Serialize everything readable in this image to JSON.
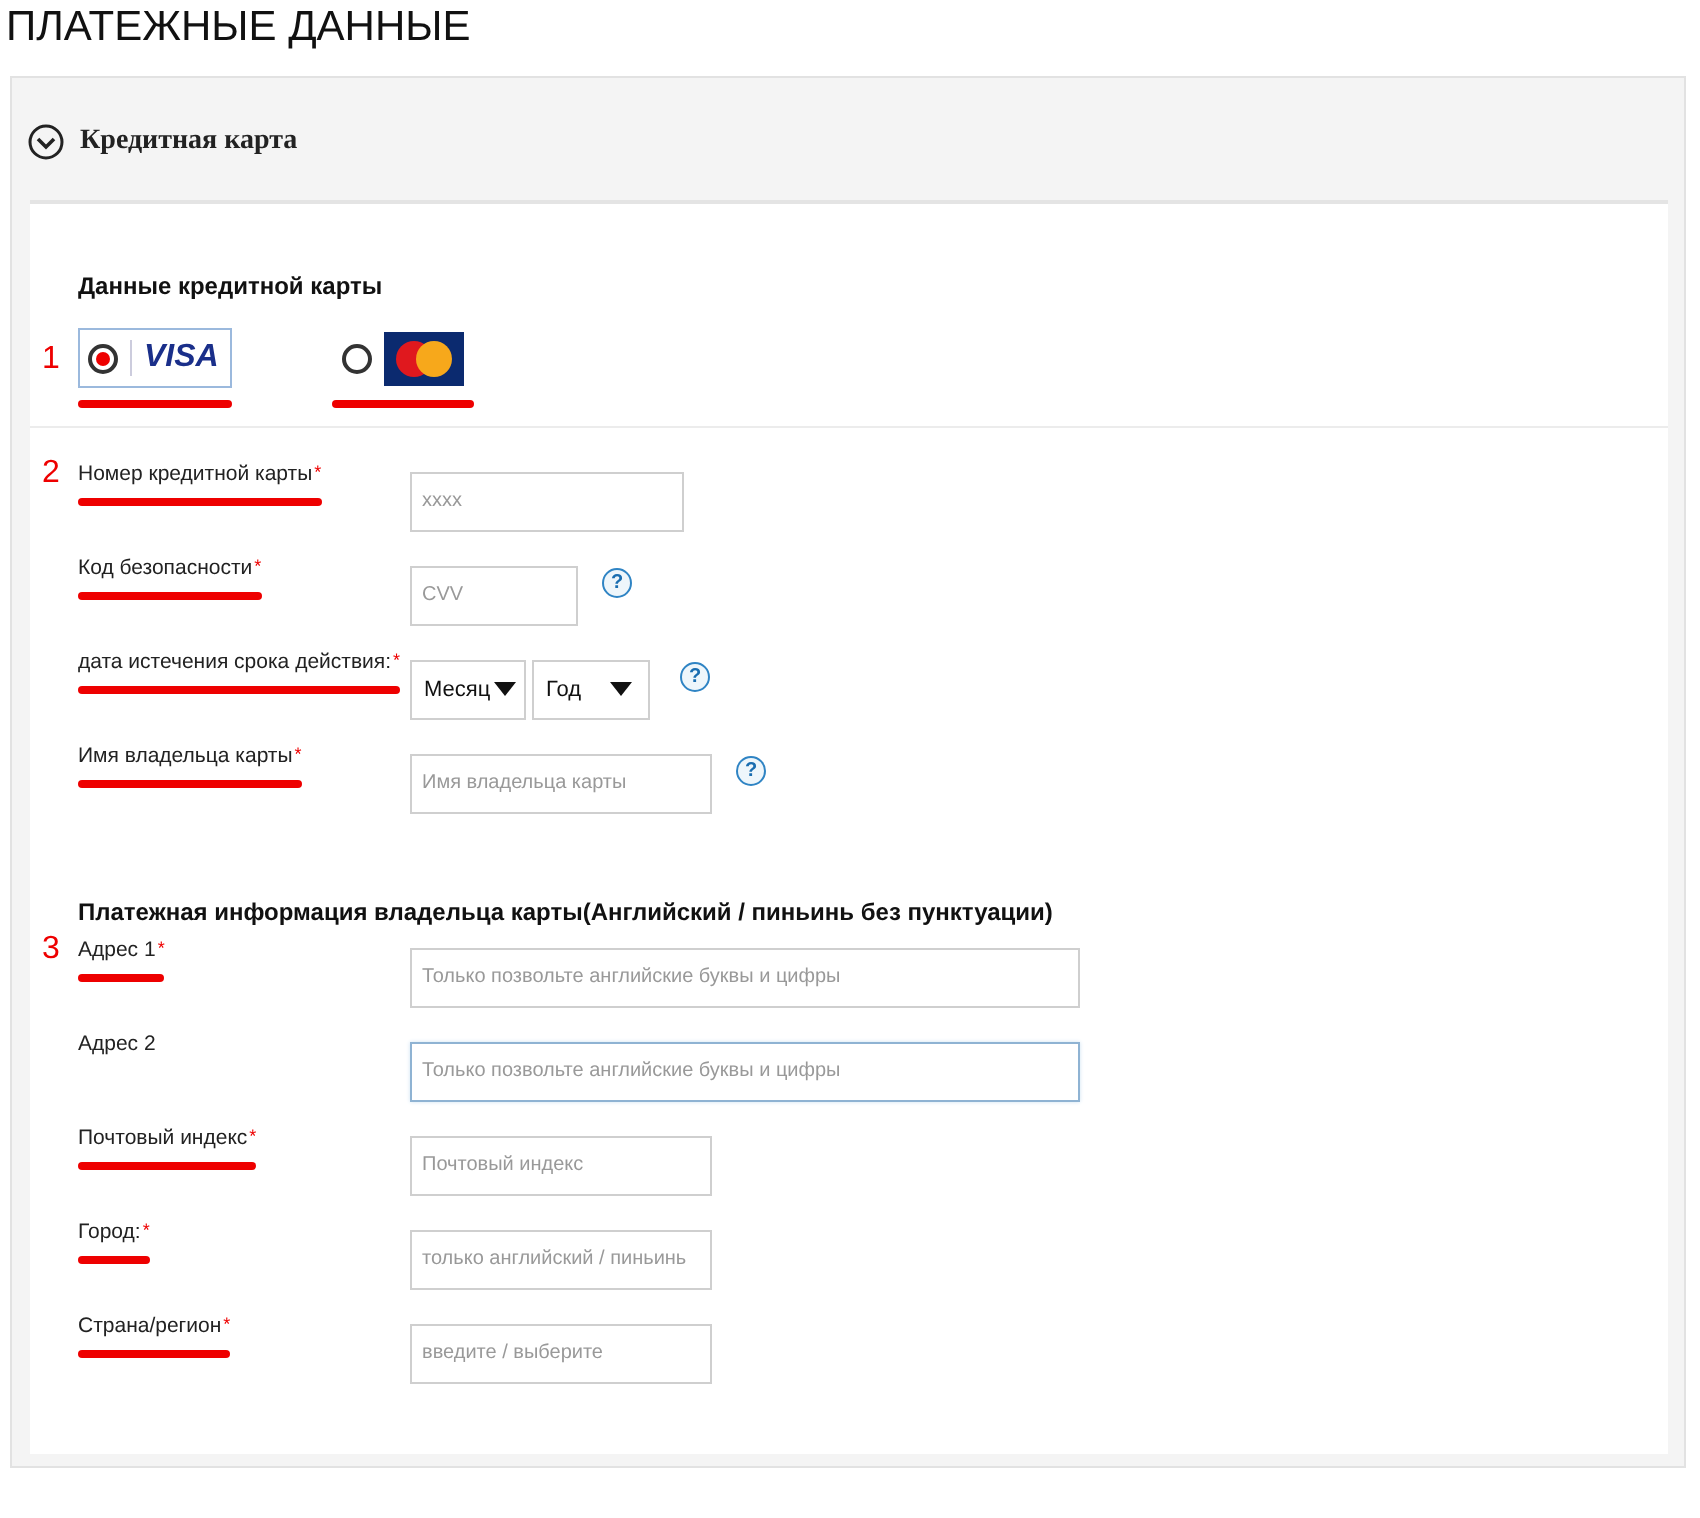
{
  "page_title": "ПЛАТЕЖНЫЕ ДАННЫЕ",
  "section": {
    "title": "Кредитная карта",
    "expanded": true
  },
  "card_heading": "Данные кредитной карты",
  "card_types": [
    {
      "kind": "visa",
      "logo_text": "VISA",
      "selected": true,
      "underlined": true,
      "marker": "1"
    },
    {
      "kind": "mastercard",
      "selected": false,
      "underlined": true
    }
  ],
  "card_fields": [
    {
      "kind": "text",
      "label": "Номер кредитной карты",
      "required_mark": "*",
      "underlined": true,
      "marker": "2",
      "placeholder": "xxxx",
      "focused": false
    },
    {
      "kind": "text",
      "label": "Код безопасности",
      "required_mark": "*",
      "underlined": true,
      "placeholder": "CVV",
      "help": "?",
      "focused": false
    },
    {
      "kind": "select",
      "label": "дата истечения срока действия:",
      "required_mark": "*",
      "underlined": true,
      "selects": [
        "Месяц",
        "Год"
      ],
      "help": "?"
    },
    {
      "kind": "text",
      "label": "Имя владельца карты",
      "required_mark": "*",
      "underlined": true,
      "placeholder": "Имя владельца карты",
      "help": "?",
      "focused": false
    }
  ],
  "billing_heading": "Платежная информация владельца карты(Английский / пиньинь без пунктуации)",
  "billing_fields": [
    {
      "kind": "text",
      "label": "Адрес 1",
      "required_mark": "*",
      "underlined": true,
      "marker": "3",
      "placeholder": "Только позвольте английские буквы и цифры",
      "focused": false
    },
    {
      "kind": "text",
      "label": "Адрес 2",
      "underlined": false,
      "placeholder": "Только позвольте английские буквы и цифры",
      "focused": true
    },
    {
      "kind": "text",
      "label": "Почтовый индекс",
      "required_mark": "*",
      "underlined": true,
      "placeholder": "Почтовый индекс",
      "focused": false
    },
    {
      "kind": "text",
      "label": "Город:",
      "required_mark": "*",
      "underlined": true,
      "placeholder": "только английский / пиньинь",
      "focused": false
    },
    {
      "kind": "text",
      "label": "Страна/регион",
      "required_mark": "*",
      "underlined": true,
      "placeholder": "введите / выберите",
      "focused": false
    }
  ]
}
